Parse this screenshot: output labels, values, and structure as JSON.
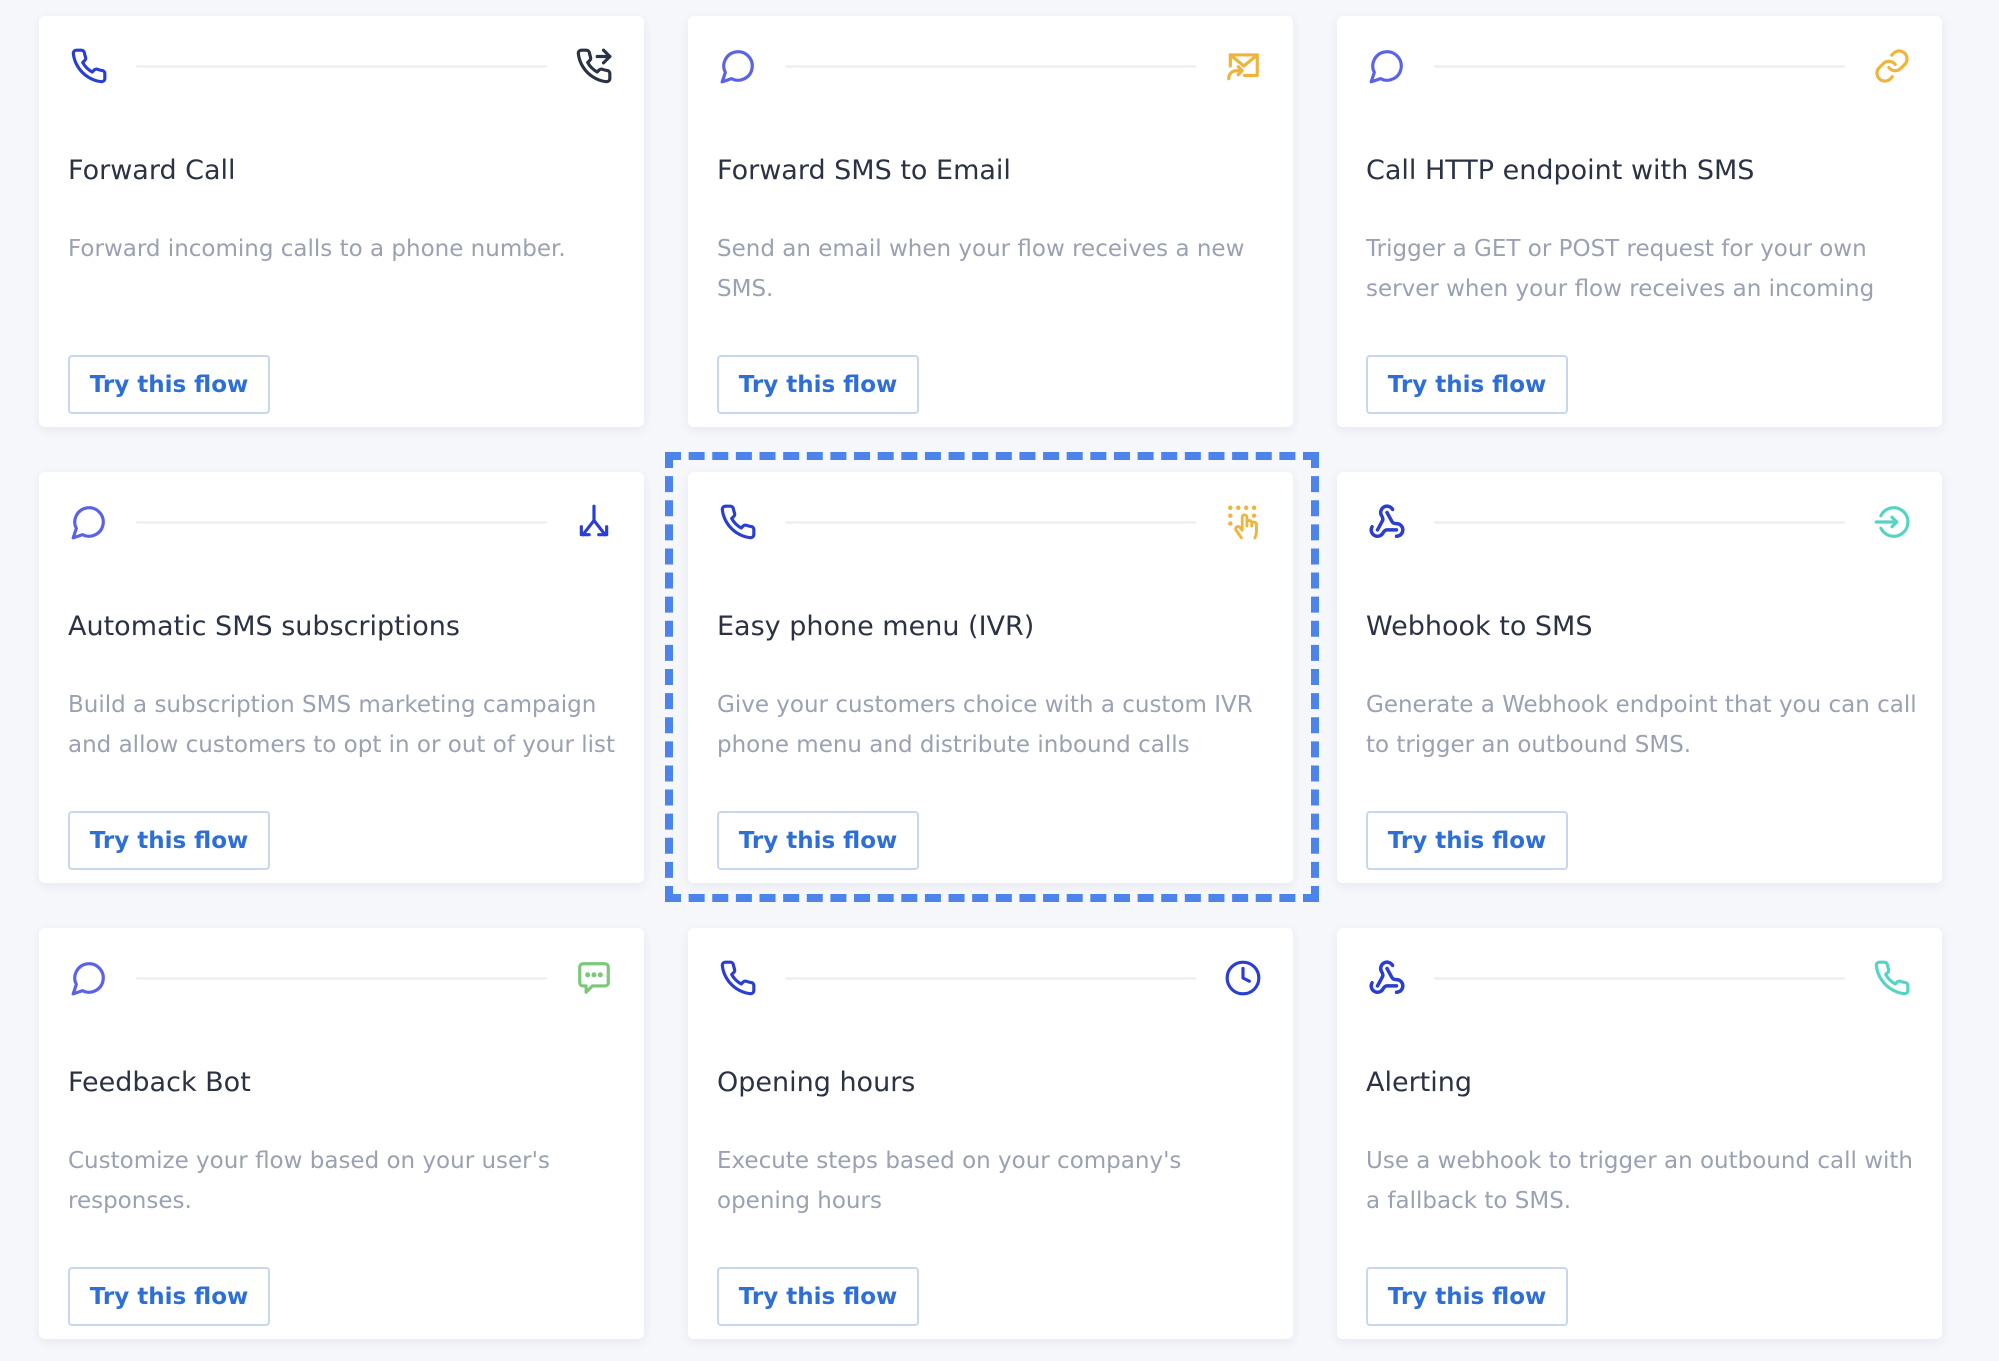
{
  "colors": {
    "page_background": "#f5f7fb",
    "card_background": "#ffffff",
    "title_text": "#2b3243",
    "description_text": "#9aa1b3",
    "button_text": "#2d6fd6",
    "button_border": "#c8d7ee",
    "selection_frame": "#4c84ec",
    "icon_dark_blue": "#2a3fd0",
    "icon_purple_blue": "#5a62e8",
    "icon_orange": "#f0b43d",
    "icon_green": "#7cc77b",
    "icon_teal": "#56d4c3",
    "icon_black": "#2b3243"
  },
  "selected_card": "Easy phone menu (IVR)",
  "cards": [
    {
      "title": "Forward Call",
      "description": "Forward incoming calls to a phone number.",
      "button_label": "Try this flow",
      "trigger_icon": "phone-icon",
      "action_icon": "phone-forward-icon"
    },
    {
      "title": "Forward SMS to Email",
      "description": "Send an email when your flow receives a new SMS.",
      "button_label": "Try this flow",
      "trigger_icon": "chat-bubble-icon",
      "action_icon": "email-forward-icon"
    },
    {
      "title": "Call HTTP endpoint with SMS",
      "description": "Trigger a GET or POST request for your own server when your flow receives an incoming",
      "button_label": "Try this flow",
      "trigger_icon": "chat-bubble-icon",
      "action_icon": "link-icon"
    },
    {
      "title": "Automatic SMS subscriptions",
      "description": "Build a subscription SMS marketing campaign and allow customers to opt in or out of your list",
      "button_label": "Try this flow",
      "trigger_icon": "chat-bubble-icon",
      "action_icon": "split-arrows-icon"
    },
    {
      "title": "Easy phone menu (IVR)",
      "description": "Give your customers choice with a custom IVR phone menu and distribute inbound calls",
      "button_label": "Try this flow",
      "trigger_icon": "phone-icon",
      "action_icon": "keypad-hand-icon"
    },
    {
      "title": "Webhook to SMS",
      "description": "Generate a Webhook endpoint that you can call to trigger an outbound SMS.",
      "button_label": "Try this flow",
      "trigger_icon": "webhook-icon",
      "action_icon": "send-arrow-icon"
    },
    {
      "title": "Feedback Bot",
      "description": "Customize your flow based on your user's responses.",
      "button_label": "Try this flow",
      "trigger_icon": "chat-bubble-icon",
      "action_icon": "speech-dots-icon"
    },
    {
      "title": "Opening hours",
      "description": "Execute steps based on your company's opening hours",
      "button_label": "Try this flow",
      "trigger_icon": "phone-icon",
      "action_icon": "clock-icon"
    },
    {
      "title": "Alerting",
      "description": "Use a webhook to trigger an outbound call with a fallback to SMS.",
      "button_label": "Try this flow",
      "trigger_icon": "webhook-icon",
      "action_icon": "phone-icon"
    }
  ]
}
